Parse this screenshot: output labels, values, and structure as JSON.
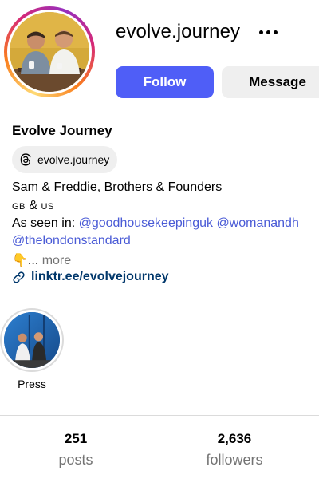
{
  "profile": {
    "username": "evolve.journey",
    "display_name": "Evolve Journey",
    "threads_handle": "evolve.journey",
    "avatar_icon": "profile-photo-two-men-at-table"
  },
  "actions": {
    "follow_label": "Follow",
    "message_label": "Message",
    "more_icon": "more-horizontal-icon"
  },
  "bio": {
    "line1": "Sam & Freddie, Brothers & Founders",
    "line2_flag1": "GB",
    "line2_amp": " & ",
    "line2_flag2": "US",
    "line3_prefix": "As seen in: ",
    "mention1": "@goodhousekeepinguk",
    "mention2": "@womanandh",
    "mention3": "@thelondonstandard",
    "line5_emoji": "👇",
    "line5_ellipsis": "... ",
    "more_label": "more"
  },
  "link": {
    "icon": "link-icon",
    "text": "linktr.ee/evolvejourney"
  },
  "highlights": [
    {
      "label": "Press",
      "icon": "press-highlight-cover"
    }
  ],
  "stats": {
    "posts_count": "251",
    "posts_label": "posts",
    "followers_count": "2,636",
    "followers_label": "followers"
  },
  "colors": {
    "follow_button": "#4f5ef7",
    "mention": "#4a5bd6",
    "link": "#00376b",
    "muted": "#737373"
  }
}
